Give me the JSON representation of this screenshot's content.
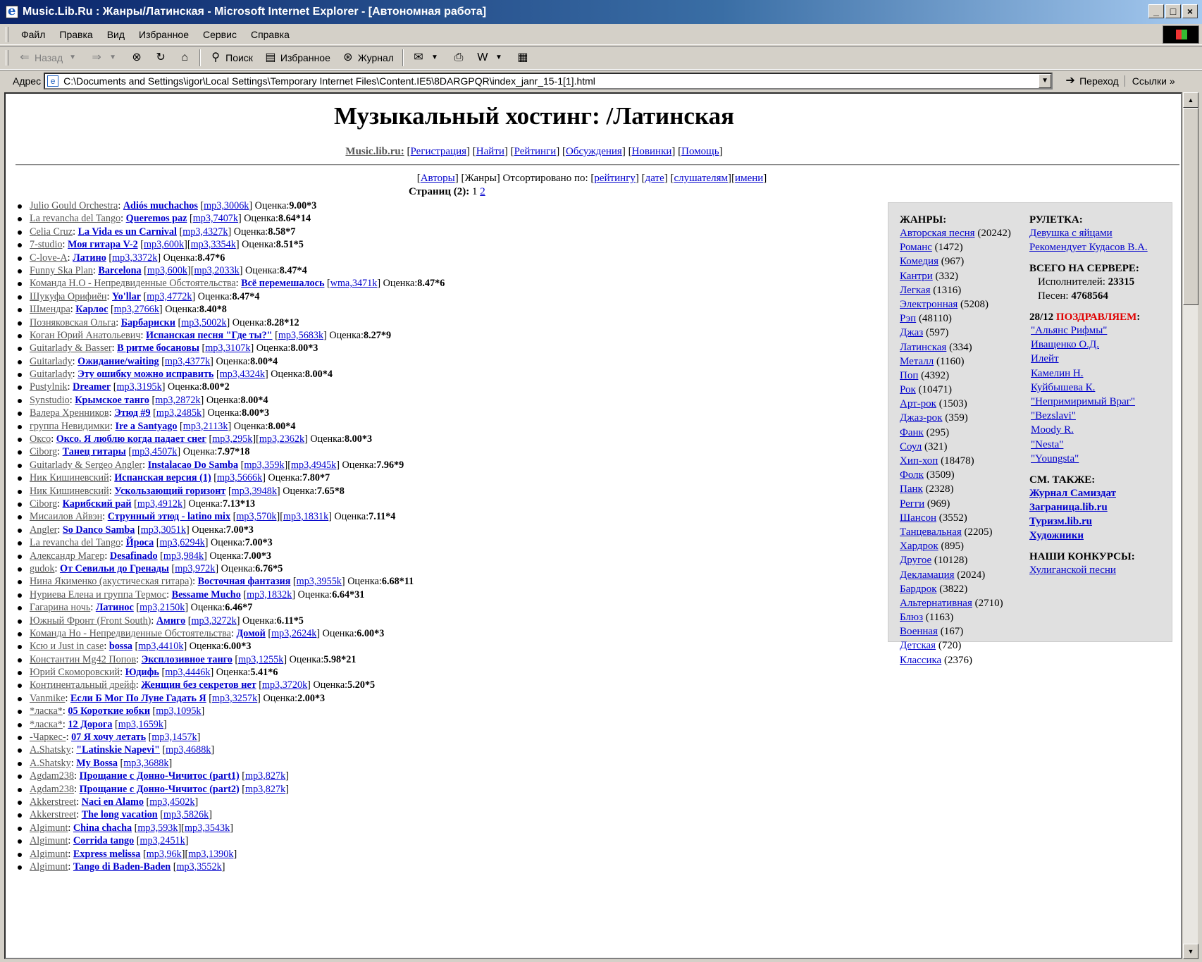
{
  "window": {
    "title": "Music.Lib.Ru : Жанры/Латинская - Microsoft Internet Explorer - [Автономная работа]",
    "min": "_",
    "max": "□",
    "close": "×"
  },
  "menu": [
    "Файл",
    "Правка",
    "Вид",
    "Избранное",
    "Сервис",
    "Справка"
  ],
  "toolbar": {
    "back": "Назад",
    "search": "Поиск",
    "favorites": "Избранное",
    "history": "Журнал"
  },
  "address": {
    "label": "Адрес",
    "url": "C:\\Documents and Settings\\igor\\Local Settings\\Temporary Internet Files\\Content.IE5\\8DARGPQR\\index_janr_15-1[1].html",
    "go": "Переход",
    "links": "Ссылки"
  },
  "page": {
    "heading": "Музыкальный хостинг: /Латинская",
    "site": "Music.lib.ru:",
    "nav": [
      "Регистрация",
      "Найти",
      "Рейтинги",
      "Обсуждения",
      "Новинки",
      "Помощь"
    ],
    "authors_link": "Авторы",
    "genres_text": "[Жанры] Отсортировано по: ",
    "sort": [
      "рейтингу",
      "дате",
      "слушателям",
      "имени"
    ],
    "pages_label": "Страниц (2):",
    "page_current": "1",
    "page_other": "2",
    "rating_label": "Оценка:"
  },
  "songs": [
    {
      "author": "Julio Gould Orchestra",
      "title": "Adiós muchachos",
      "files": [
        "mp3,3006k"
      ],
      "rating": "9.00*3"
    },
    {
      "author": "La revancha del Tango",
      "title": "Queremos paz",
      "files": [
        "mp3,7407k"
      ],
      "rating": "8.64*14"
    },
    {
      "author": "Celia Cruz",
      "title": "La Vida es un Carnival",
      "files": [
        "mp3,4327k"
      ],
      "rating": "8.58*7"
    },
    {
      "author": "7-studio",
      "title": "Моя гитара V-2",
      "files": [
        "mp3,600k",
        "mp3,3354k"
      ],
      "rating": "8.51*5"
    },
    {
      "author": "C-love-A",
      "title": "Латино",
      "files": [
        "mp3,3372k"
      ],
      "rating": "8.47*6"
    },
    {
      "author": "Funny Ska Plan",
      "title": "Barcelona",
      "files": [
        "mp3,600k",
        "mp3,2033k"
      ],
      "rating": "8.47*4"
    },
    {
      "author": "Команда Н.О - Непредвиденные Обстоятельства",
      "title": "Всё перемешалось",
      "files": [
        "wma,3471k"
      ],
      "rating": "8.47*6"
    },
    {
      "author": "Шукуфа Орифиён",
      "title": "Yo'llar",
      "files": [
        "mp3,4772k"
      ],
      "rating": "8.47*4"
    },
    {
      "author": "Шмендра",
      "title": "Карлос",
      "files": [
        "mp3,2766k"
      ],
      "rating": "8.40*8"
    },
    {
      "author": "Позняковская Ольга",
      "title": "Барбариски",
      "files": [
        "mp3,5002k"
      ],
      "rating": "8.28*12"
    },
    {
      "author": "Коган Юрий Анатольевич",
      "title": "Испанская песня \"Где ты?\"",
      "files": [
        "mp3,5683k"
      ],
      "rating": "8.27*9"
    },
    {
      "author": "Guitarlady & Basser",
      "title": "В ритме босановы",
      "files": [
        "mp3,3107k"
      ],
      "rating": "8.00*3"
    },
    {
      "author": "Guitarlady",
      "title": "Ожидание/waiting",
      "files": [
        "mp3,4377k"
      ],
      "rating": "8.00*4"
    },
    {
      "author": "Guitarlady",
      "title": "Эту ошибку можно исправить",
      "files": [
        "mp3,4324k"
      ],
      "rating": "8.00*4"
    },
    {
      "author": "Pustylnik",
      "title": "Dreamer",
      "files": [
        "mp3,3195k"
      ],
      "rating": "8.00*2"
    },
    {
      "author": "Synstudio",
      "title": "Крымское танго",
      "files": [
        "mp3,2872k"
      ],
      "rating": "8.00*4"
    },
    {
      "author": "Валера Хренников",
      "title": "Этюд #9",
      "files": [
        "mp3,2485k"
      ],
      "rating": "8.00*3"
    },
    {
      "author": "группа Невидимки",
      "title": "Ire a Santyago",
      "files": [
        "mp3,2113k"
      ],
      "rating": "8.00*4"
    },
    {
      "author": "Оксо",
      "title": "Оксо. Я люблю когда падает снег",
      "files": [
        "mp3,295k",
        "mp3,2362k"
      ],
      "rating": "8.00*3"
    },
    {
      "author": "Ciborg",
      "title": "Танец гитары",
      "files": [
        "mp3,4507k"
      ],
      "rating": "7.97*18"
    },
    {
      "author": "Guitarlady & Sergeo Angler",
      "title": "Instalacao Do Samba",
      "files": [
        "mp3,359k",
        "mp3,4945k"
      ],
      "rating": "7.96*9"
    },
    {
      "author": "Ник Кишиневский",
      "title": "Испанская версия (1)",
      "files": [
        "mp3,5666k"
      ],
      "rating": "7.80*7"
    },
    {
      "author": "Ник Кишиневский",
      "title": "Ускользающий горизонт",
      "files": [
        "mp3,3948k"
      ],
      "rating": "7.65*8"
    },
    {
      "author": "Ciborg",
      "title": "Карибский рай",
      "files": [
        "mp3,4912k"
      ],
      "rating": "7.13*13"
    },
    {
      "author": "Мисаилов Айвэн",
      "title": "Струнный этюд - latino mix",
      "files": [
        "mp3,570k",
        "mp3,1831k"
      ],
      "rating": "7.11*4"
    },
    {
      "author": "Angler",
      "title": "So Danco Samba",
      "files": [
        "mp3,3051k"
      ],
      "rating": "7.00*3"
    },
    {
      "author": "La revancha del Tango",
      "title": "Йроса",
      "files": [
        "mp3,6294k"
      ],
      "rating": "7.00*3"
    },
    {
      "author": "Александр Магер",
      "title": "Desafinado",
      "files": [
        "mp3,984k"
      ],
      "rating": "7.00*3"
    },
    {
      "author": "gudok",
      "title": "От Севильи до Гренады",
      "files": [
        "mp3,972k"
      ],
      "rating": "6.76*5"
    },
    {
      "author": "Нина Якименко (акустическая гитара)",
      "title": "Восточная фантазия",
      "files": [
        "mp3,3955k"
      ],
      "rating": "6.68*11"
    },
    {
      "author": "Нуриева Елена и группа Термос",
      "title": "Bessame Mucho",
      "files": [
        "mp3,1832k"
      ],
      "rating": "6.64*31"
    },
    {
      "author": "Гагарина ночь",
      "title": "Латинос",
      "files": [
        "mp3,2150k"
      ],
      "rating": "6.46*7"
    },
    {
      "author": "Южный Фронт (Front South)",
      "title": "Амиго",
      "files": [
        "mp3,3272k"
      ],
      "rating": "6.11*5"
    },
    {
      "author": "Команда Но - Непредвиденные Обстоятельства",
      "title": "Домой",
      "files": [
        "mp3,2624k"
      ],
      "rating": "6.00*3"
    },
    {
      "author": "Ксю и Just in case",
      "title": "bossa",
      "files": [
        "mp3,4410k"
      ],
      "rating": "6.00*3"
    },
    {
      "author": "Константин Mg42 Попов",
      "title": "Эксплозивное танго",
      "files": [
        "mp3,1255k"
      ],
      "rating": "5.98*21"
    },
    {
      "author": "Юрий Скоморовский",
      "title": "Юдифь",
      "files": [
        "mp3,4446k"
      ],
      "rating": "5.41*6"
    },
    {
      "author": "Континентальный дрейф",
      "title": "Женщин без секретов нет",
      "files": [
        "mp3,3720k"
      ],
      "rating": "5.20*5"
    },
    {
      "author": "Vanmike",
      "title": "Если Б Мог По Луне Гадать Я",
      "files": [
        "mp3,3257k"
      ],
      "rating": "2.00*3"
    },
    {
      "author": "*ласка*",
      "title": "05 Короткие юбки",
      "files": [
        "mp3,1095k"
      ],
      "rating": ""
    },
    {
      "author": "*ласка*",
      "title": "12 Дорога",
      "files": [
        "mp3,1659k"
      ],
      "rating": ""
    },
    {
      "author": "-Чаркес-",
      "title": "07 Я хочу летать",
      "files": [
        "mp3,1457k"
      ],
      "rating": ""
    },
    {
      "author": "A.Shatsky",
      "title": "\"Latinskie Napevi\"",
      "files": [
        "mp3,4688k"
      ],
      "rating": ""
    },
    {
      "author": "A.Shatsky",
      "title": "My Bossa",
      "files": [
        "mp3,3688k"
      ],
      "rating": ""
    },
    {
      "author": "Agdam238",
      "title": "Прощание с Донно-Чичитос (part1)",
      "files": [
        "mp3,827k"
      ],
      "rating": ""
    },
    {
      "author": "Agdam238",
      "title": "Прощание с Донно-Чичитос (part2)",
      "files": [
        "mp3,827k"
      ],
      "rating": ""
    },
    {
      "author": "Akkerstreet",
      "title": "Naci en Alamo",
      "files": [
        "mp3,4502k"
      ],
      "rating": ""
    },
    {
      "author": "Akkerstreet",
      "title": "The long vacation",
      "files": [
        "mp3,5826k"
      ],
      "rating": ""
    },
    {
      "author": "Algimunt",
      "title": "China chacha",
      "files": [
        "mp3,593k",
        "mp3,3543k"
      ],
      "rating": ""
    },
    {
      "author": "Algimunt",
      "title": "Corrida tango",
      "files": [
        "mp3,2451k"
      ],
      "rating": ""
    },
    {
      "author": "Algimunt",
      "title": "Express melissa",
      "files": [
        "mp3,96k",
        "mp3,1390k"
      ],
      "rating": ""
    },
    {
      "author": "Algimunt",
      "title": "Tango di Baden-Baden",
      "files": [
        "mp3,3552k"
      ],
      "rating": ""
    }
  ],
  "sidebar": {
    "genres_title": "ЖАНРЫ:",
    "genres": [
      {
        "name": "Авторская песня",
        "count": "(20242)"
      },
      {
        "name": "Романс",
        "count": "(1472)"
      },
      {
        "name": "Комедия",
        "count": "(967)"
      },
      {
        "name": "Кантри",
        "count": "(332)"
      },
      {
        "name": "Легкая",
        "count": "(1316)"
      },
      {
        "name": "Электронная",
        "count": "(5208)"
      },
      {
        "name": "Рэп",
        "count": "(48110)"
      },
      {
        "name": "Джаз",
        "count": "(597)"
      },
      {
        "name": "Латинская",
        "count": "(334)"
      },
      {
        "name": "Металл",
        "count": "(1160)"
      },
      {
        "name": "Поп",
        "count": "(4392)"
      },
      {
        "name": "Рок",
        "count": "(10471)"
      },
      {
        "name": "Арт-рок",
        "count": "(1503)"
      },
      {
        "name": "Джаз-рок",
        "count": "(359)"
      },
      {
        "name": "Фанк",
        "count": "(295)"
      },
      {
        "name": "Соул",
        "count": "(321)"
      },
      {
        "name": "Хип-хоп",
        "count": "(18478)"
      },
      {
        "name": "Фолк",
        "count": "(3509)"
      },
      {
        "name": "Панк",
        "count": "(2328)"
      },
      {
        "name": "Регги",
        "count": "(969)"
      },
      {
        "name": "Шансон",
        "count": "(3552)"
      },
      {
        "name": "Танцевальная",
        "count": "(2205)"
      },
      {
        "name": "Хардрок",
        "count": "(895)"
      },
      {
        "name": "Другое",
        "count": "(10128)"
      },
      {
        "name": "Декламация",
        "count": "(2024)"
      },
      {
        "name": "Бардрок",
        "count": "(3822)"
      },
      {
        "name": "Альтернативная",
        "count": "(2710)"
      },
      {
        "name": "Блюз",
        "count": "(1163)"
      },
      {
        "name": "Военная",
        "count": "(167)"
      },
      {
        "name": "Детская",
        "count": "(720)"
      },
      {
        "name": "Классика",
        "count": "(2376)"
      }
    ],
    "roulette_title": "РУЛЕТКА:",
    "roulette": [
      "Девушка с яйцами",
      "Рекомендует Кудасов В.А."
    ],
    "total_title": "ВСЕГО НА СЕРВЕРЕ:",
    "performers_label": "Исполнителей:",
    "performers": "23315",
    "songs_label": "Песен:",
    "songs": "4768564",
    "congrat_date": "28/12",
    "congrat_word": "ПОЗДРАВЛЯЕМ",
    "congrat_colon": ":",
    "congrat": [
      "\"Альянс Рифмы\"",
      "Иващенко О.Д.",
      "Илейт",
      "Камелин Н.",
      "Куйбышева К.",
      "\"Непримиримый Враг\"",
      "\"Bezslavi\"",
      "Moody R.",
      "\"Nesta\"",
      "\"Youngsta\""
    ],
    "seealso_title": "СМ. ТАКЖЕ:",
    "seealso": [
      "Журнал Самиздат",
      "Заграница.lib.ru",
      "Туризм.lib.ru",
      "Художники"
    ],
    "contests_title": "НАШИ КОНКУРСЫ:",
    "contests": [
      "Хулиганской песни"
    ]
  }
}
